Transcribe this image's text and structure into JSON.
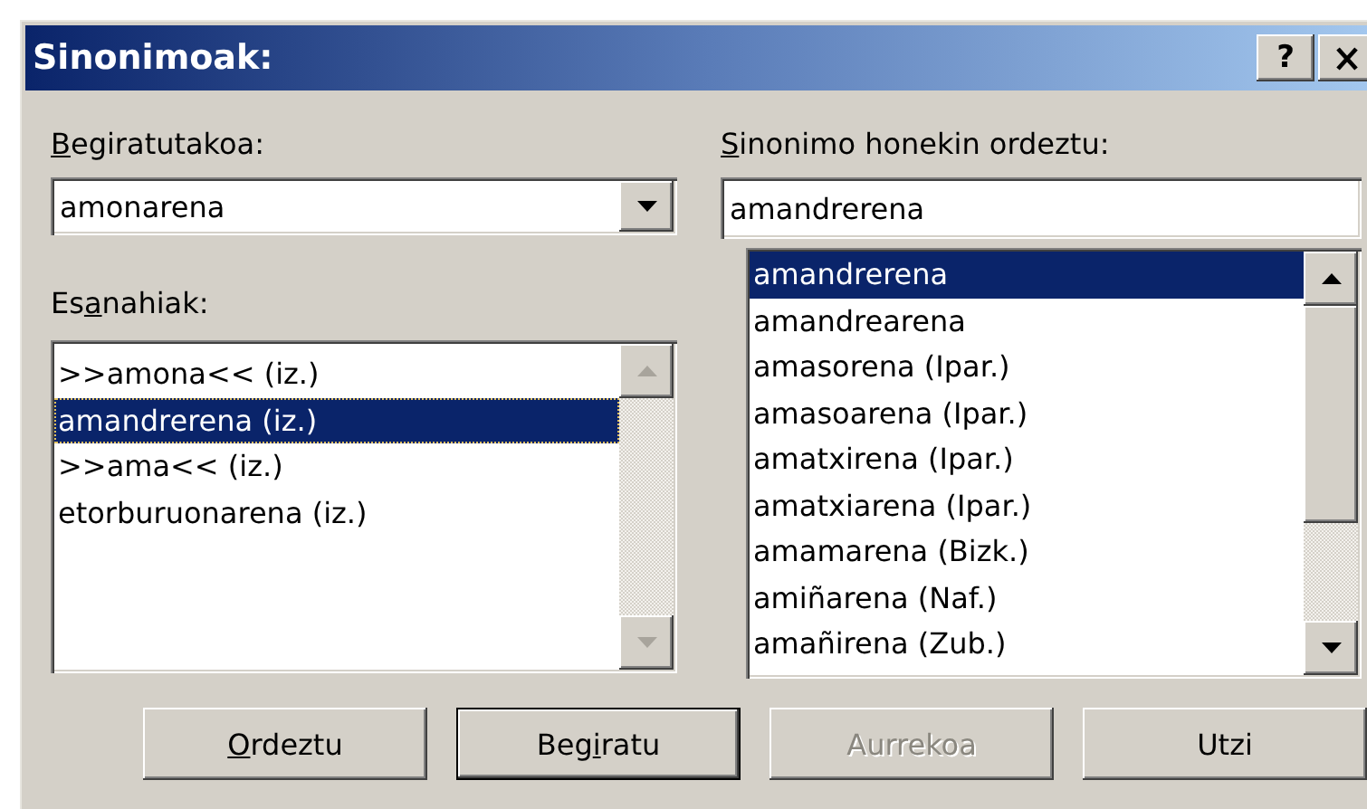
{
  "window": {
    "title": "Sinonimoak:",
    "help_button": "?"
  },
  "looked_up": {
    "label": {
      "key": "B",
      "post": "egiratutakoa:"
    },
    "value": "amonarena"
  },
  "meanings": {
    "label": {
      "pre": "Es",
      "key": "a",
      "post": "nahiak:"
    },
    "items": [
      {
        "text": ">>amona<< (iz.)",
        "selected": false
      },
      {
        "text": "amandrerena (iz.)",
        "selected": true
      },
      {
        "text": ">>ama<< (iz.)",
        "selected": false
      },
      {
        "text": "etorburuonarena (iz.)",
        "selected": false
      }
    ]
  },
  "replace_with": {
    "label": {
      "key": "S",
      "post": "inonimo honekin ordeztu:"
    },
    "value": "amandrerena",
    "items": [
      {
        "text": "amandrerena",
        "selected": true
      },
      {
        "text": "amandrearena",
        "selected": false
      },
      {
        "text": "amasorena (Ipar.)",
        "selected": false
      },
      {
        "text": "amasoarena (Ipar.)",
        "selected": false
      },
      {
        "text": "amatxirena (Ipar.)",
        "selected": false
      },
      {
        "text": "amatxiarena (Ipar.)",
        "selected": false
      },
      {
        "text": "amamarena (Bizk.)",
        "selected": false
      },
      {
        "text": "amiñarena (Naf.)",
        "selected": false
      },
      {
        "text": "amañirena (Zub.)",
        "selected": false
      }
    ]
  },
  "buttons": [
    {
      "label": {
        "key": "O",
        "post": "rdeztu"
      },
      "disabled": false,
      "default": false
    },
    {
      "label": {
        "pre": "Beg",
        "key": "i",
        "post": "ratu"
      },
      "disabled": false,
      "default": true
    },
    {
      "label": {
        "pre": "Aurrekoa"
      },
      "disabled": true,
      "default": false
    },
    {
      "label": {
        "pre": "Utzi"
      },
      "disabled": false,
      "default": false
    }
  ]
}
